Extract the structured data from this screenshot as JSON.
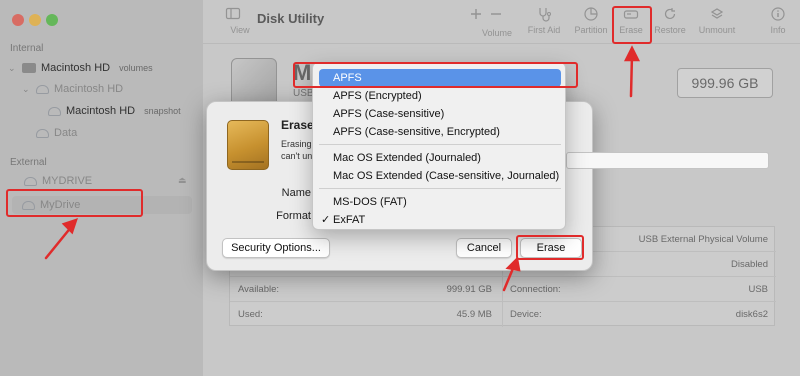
{
  "app": {
    "title": "Disk Utility"
  },
  "toolbar": {
    "view": "View",
    "volume": "Volume",
    "first_aid": "First Aid",
    "partition": "Partition",
    "erase": "Erase",
    "restore": "Restore",
    "unmount": "Unmount",
    "info": "Info"
  },
  "sidebar": {
    "internal_header": "Internal",
    "external_header": "External",
    "items": [
      {
        "label": "Macintosh HD",
        "sub": "volumes"
      },
      {
        "label": "Macintosh HD",
        "sub": ""
      },
      {
        "label": "Macintosh HD",
        "sub": "snapshot"
      },
      {
        "label": "Data",
        "sub": ""
      },
      {
        "label": "MYDRIVE",
        "sub": ""
      },
      {
        "label": "MyDrive",
        "sub": ""
      }
    ]
  },
  "header": {
    "name_partial": "M",
    "sub_partial": "USB",
    "size": "999.96 GB"
  },
  "info_table": {
    "rows": [
      {
        "right_value": "USB External Physical Volume"
      },
      {
        "right_value": "Disabled"
      },
      {
        "left_label": "Available:",
        "left_value": "999.91 GB",
        "right_label": "Connection:",
        "right_value": "USB"
      },
      {
        "left_label": "Used:",
        "left_value": "45.9 MB",
        "right_label": "Device:",
        "right_value": "disk6s2"
      }
    ]
  },
  "dialog": {
    "title": "Erase \"",
    "text_line1": "Erasing",
    "text_line2": "can't un",
    "name_label": "Name",
    "format_label": "Format",
    "security_button": "Security Options...",
    "cancel_button": "Cancel",
    "erase_button": "Erase"
  },
  "format_menu": {
    "group1": [
      "APFS",
      "APFS (Encrypted)",
      "APFS (Case-sensitive)",
      "APFS (Case-sensitive, Encrypted)"
    ],
    "group2": [
      "Mac OS Extended (Journaled)",
      "Mac OS Extended (Case-sensitive, Journaled)"
    ],
    "group3": [
      "MS-DOS (FAT)",
      "ExFAT"
    ],
    "highlighted": "APFS",
    "checked": "ExFAT",
    "check_mark": "✓"
  },
  "colors": {
    "highlight_blue": "#5a93e8",
    "annotation_red": "#e02b2b",
    "traffic_red": "#ed6a5e",
    "traffic_yellow": "#f5bf4f",
    "traffic_green": "#61c554"
  }
}
